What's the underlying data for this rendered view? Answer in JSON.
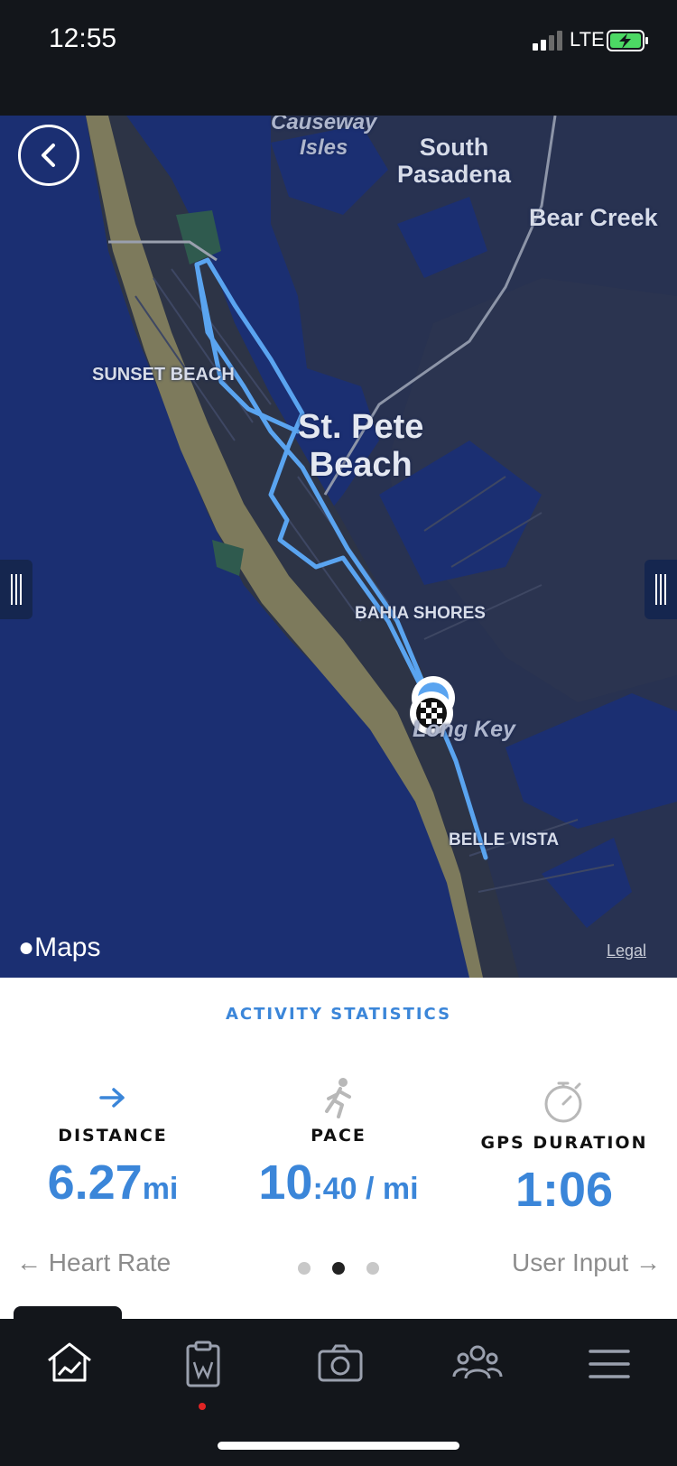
{
  "status_bar": {
    "time": "12:55",
    "network": "LTE"
  },
  "map": {
    "labels": {
      "causeway": "Causeway\nIsles",
      "south_pasadena": "South\nPasadena",
      "bear_creek": "Bear Creek",
      "sunset_beach": "SUNSET BEACH",
      "st_pete": "St. Pete\nBeach",
      "bahia_shores": "BAHIA SHORES",
      "long_key": "Long Key",
      "belle_vista": "BELLE VISTA"
    },
    "attribution": "Maps",
    "legal": "Legal",
    "colors": {
      "water": "#1b2f72",
      "land": "#2d3446",
      "beach": "#7d7a5c",
      "route": "#5aa4f0"
    }
  },
  "stats": {
    "heading": "ACTIVITY STATISTICS",
    "distance": {
      "label": "DISTANCE",
      "value": "6.27",
      "unit": "mi"
    },
    "pace": {
      "label": "PACE",
      "value": "10",
      "unit": ":40 / mi"
    },
    "gps_duration": {
      "label": "GPS DURATION",
      "value": "1:06"
    },
    "prev": "← Heart Rate",
    "next": "User Input →",
    "page_index": 2,
    "page_count": 3,
    "accent": "#3b86d9"
  },
  "tabs": [
    {
      "icon": "home-chart-icon"
    },
    {
      "icon": "clipboard-icon"
    },
    {
      "icon": "camera-icon"
    },
    {
      "icon": "community-icon"
    },
    {
      "icon": "menu-icon"
    }
  ]
}
